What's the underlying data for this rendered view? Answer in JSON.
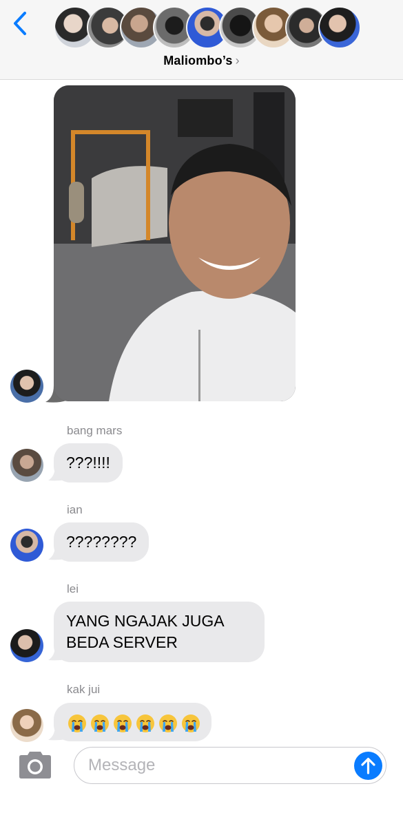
{
  "header": {
    "group_name": "Maliombo’s",
    "chevron": "›",
    "back_icon": "chevron-left-icon",
    "member_avatar_count": 9
  },
  "messages": [
    {
      "type": "photo",
      "description_icon": "photo-attachment"
    },
    {
      "sender": "bang mars",
      "text": "???!!!!"
    },
    {
      "sender": "ian",
      "text": "????????"
    },
    {
      "sender": "lei",
      "text": "YANG NGAJAK JUGA BEDA SERVER"
    },
    {
      "sender": "kak jui",
      "emoji_count": 6,
      "emoji_icon": "loudly-crying-face-emoji"
    }
  ],
  "composer": {
    "placeholder": "Message",
    "camera_icon": "camera-icon",
    "send_icon": "arrow-up-icon"
  },
  "colors": {
    "header_bg": "#f6f6f6",
    "bubble_bg": "#e9e9eb",
    "accent_blue": "#0a7cff",
    "label_gray": "#8a8a8e"
  }
}
